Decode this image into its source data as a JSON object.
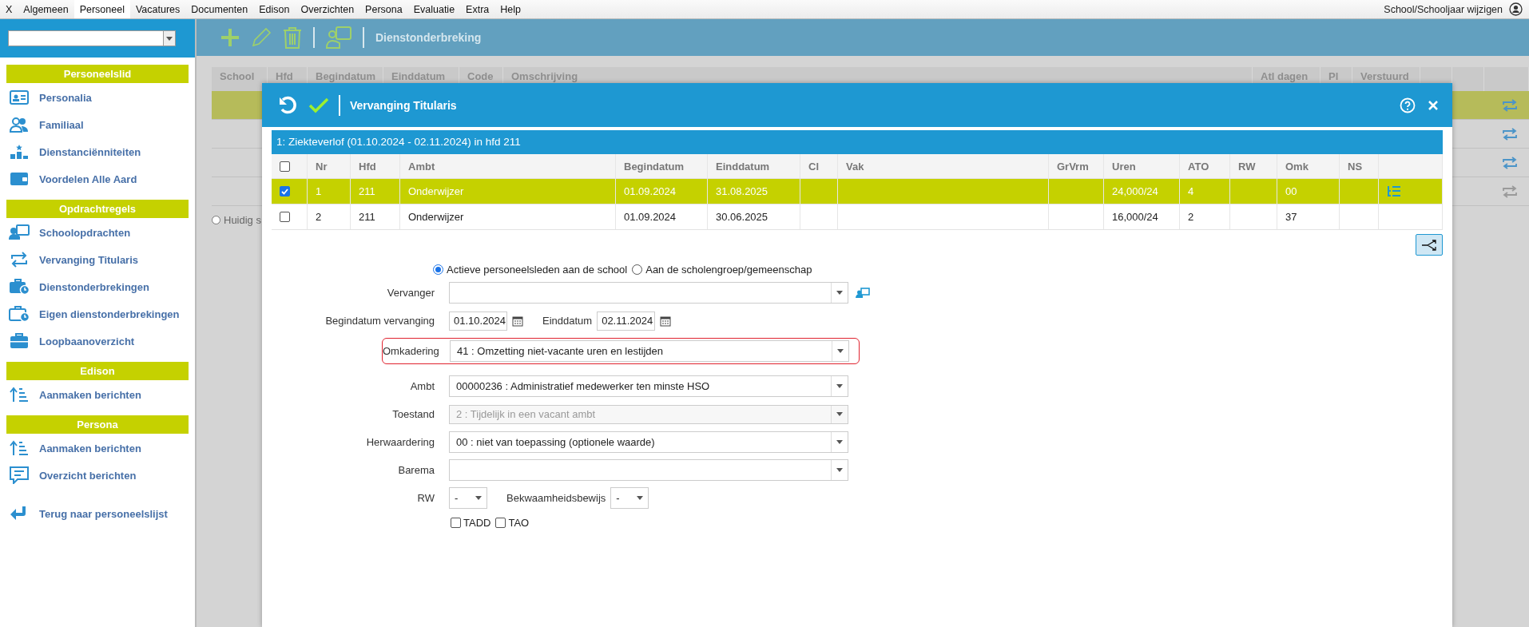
{
  "menu_bar": {
    "items": [
      {
        "label": "X",
        "selected": false
      },
      {
        "label": "Algemeen",
        "selected": false
      },
      {
        "label": "Personeel",
        "selected": true
      },
      {
        "label": "Vacatures",
        "selected": false
      },
      {
        "label": "Documenten",
        "selected": false
      },
      {
        "label": "Edison",
        "selected": false
      },
      {
        "label": "Overzichten",
        "selected": false
      },
      {
        "label": "Persona",
        "selected": false
      },
      {
        "label": "Evaluatie",
        "selected": false
      },
      {
        "label": "Extra",
        "selected": false
      },
      {
        "label": "Help",
        "selected": false
      }
    ],
    "right_link": "School/Schooljaar wijzigen"
  },
  "sidebar": {
    "sections": [
      {
        "title": "Personeelslid",
        "items": [
          "Personalia",
          "Familiaal",
          "Dienstanciënniteiten",
          "Voordelen Alle Aard"
        ]
      },
      {
        "title": "Opdrachtregels",
        "items": [
          "Schoolopdrachten",
          "Vervanging Titularis",
          "Dienstonderbrekingen",
          "Eigen dienstonderbrekingen",
          "Loopbaanoverzicht"
        ]
      },
      {
        "title": "Edison",
        "items": [
          "Aanmaken berichten"
        ]
      },
      {
        "title": "Persona",
        "items": [
          "Aanmaken berichten",
          "Overzicht berichten"
        ]
      }
    ],
    "back_link": "Terug naar personeelslijst"
  },
  "toolbar": {
    "title": "Dienstonderbreking"
  },
  "background_table": {
    "columns": [
      "School",
      "Hfd",
      "Begindatum",
      "Einddatum",
      "Code",
      "Omschrijving",
      "Atl dagen",
      "Pl",
      "Verstuurd"
    ],
    "rows": [
      {
        "selected": true,
        "disabled": false
      },
      {
        "selected": false,
        "disabled": false
      },
      {
        "selected": false,
        "disabled": false
      },
      {
        "selected": false,
        "disabled": true
      }
    ],
    "radio_selected": false,
    "radio_label": "Huidig s"
  },
  "dialog": {
    "title": "Vervanging Titularis",
    "subheader": "1: Ziekteverlof (01.10.2024 - 02.11.2024) in hfd 211",
    "table": {
      "columns": [
        "Nr",
        "Hfd",
        "Ambt",
        "Begindatum",
        "Einddatum",
        "Cl",
        "Vak",
        "GrVrm",
        "Uren",
        "ATO",
        "RW",
        "Omk",
        "NS"
      ],
      "all_checked": false,
      "rows": [
        {
          "checked": true,
          "selected": true,
          "detail": true,
          "cells": [
            "1",
            "211",
            "Onderwijzer",
            "01.09.2024",
            "31.08.2025",
            "",
            "",
            "",
            "24,000/24",
            "4",
            "",
            "00",
            ""
          ]
        },
        {
          "checked": false,
          "selected": false,
          "detail": false,
          "cells": [
            "2",
            "211",
            "Onderwijzer",
            "01.09.2024",
            "30.06.2025",
            "",
            "",
            "",
            "16,000/24",
            "2",
            "",
            "37",
            ""
          ]
        }
      ]
    },
    "radios": [
      {
        "label": "Actieve personeelsleden aan de school",
        "selected": true
      },
      {
        "label": "Aan de scholengroep/gemeenschap",
        "selected": false
      }
    ],
    "fields": [
      {
        "kind": "select",
        "label": "Vervanger",
        "disabled": false,
        "action": true
      },
      {
        "kind": "dates",
        "label": "Begindatum vervanging",
        "value": "01.10.2024",
        "label2": "Einddatum",
        "value2": "02.11.2024"
      },
      {
        "kind": "select",
        "label": "Omkadering",
        "value": "41 : Omzetting niet-vacante uren en lestijden",
        "disabled": false,
        "highlighted": true
      },
      {
        "kind": "select",
        "label": "Ambt",
        "value": "00000236 : Administratief medewerker ten minste HSO",
        "disabled": false
      },
      {
        "kind": "select",
        "label": "Toestand",
        "value": "2 : Tijdelijk in een vacant ambt",
        "disabled": true
      },
      {
        "kind": "select",
        "label": "Herwaardering",
        "value": "00 : niet van toepassing (optionele waarde)",
        "disabled": false
      },
      {
        "kind": "select",
        "label": "Barema",
        "disabled": false
      },
      {
        "kind": "small-selects",
        "label": "RW",
        "value": "-",
        "label2": "Bekwaamheidsbewijs",
        "value2": "-"
      },
      {
        "kind": "checkboxes",
        "items": [
          {
            "label": "TADD",
            "checked": false
          },
          {
            "label": "TAO",
            "checked": false
          }
        ]
      }
    ]
  }
}
